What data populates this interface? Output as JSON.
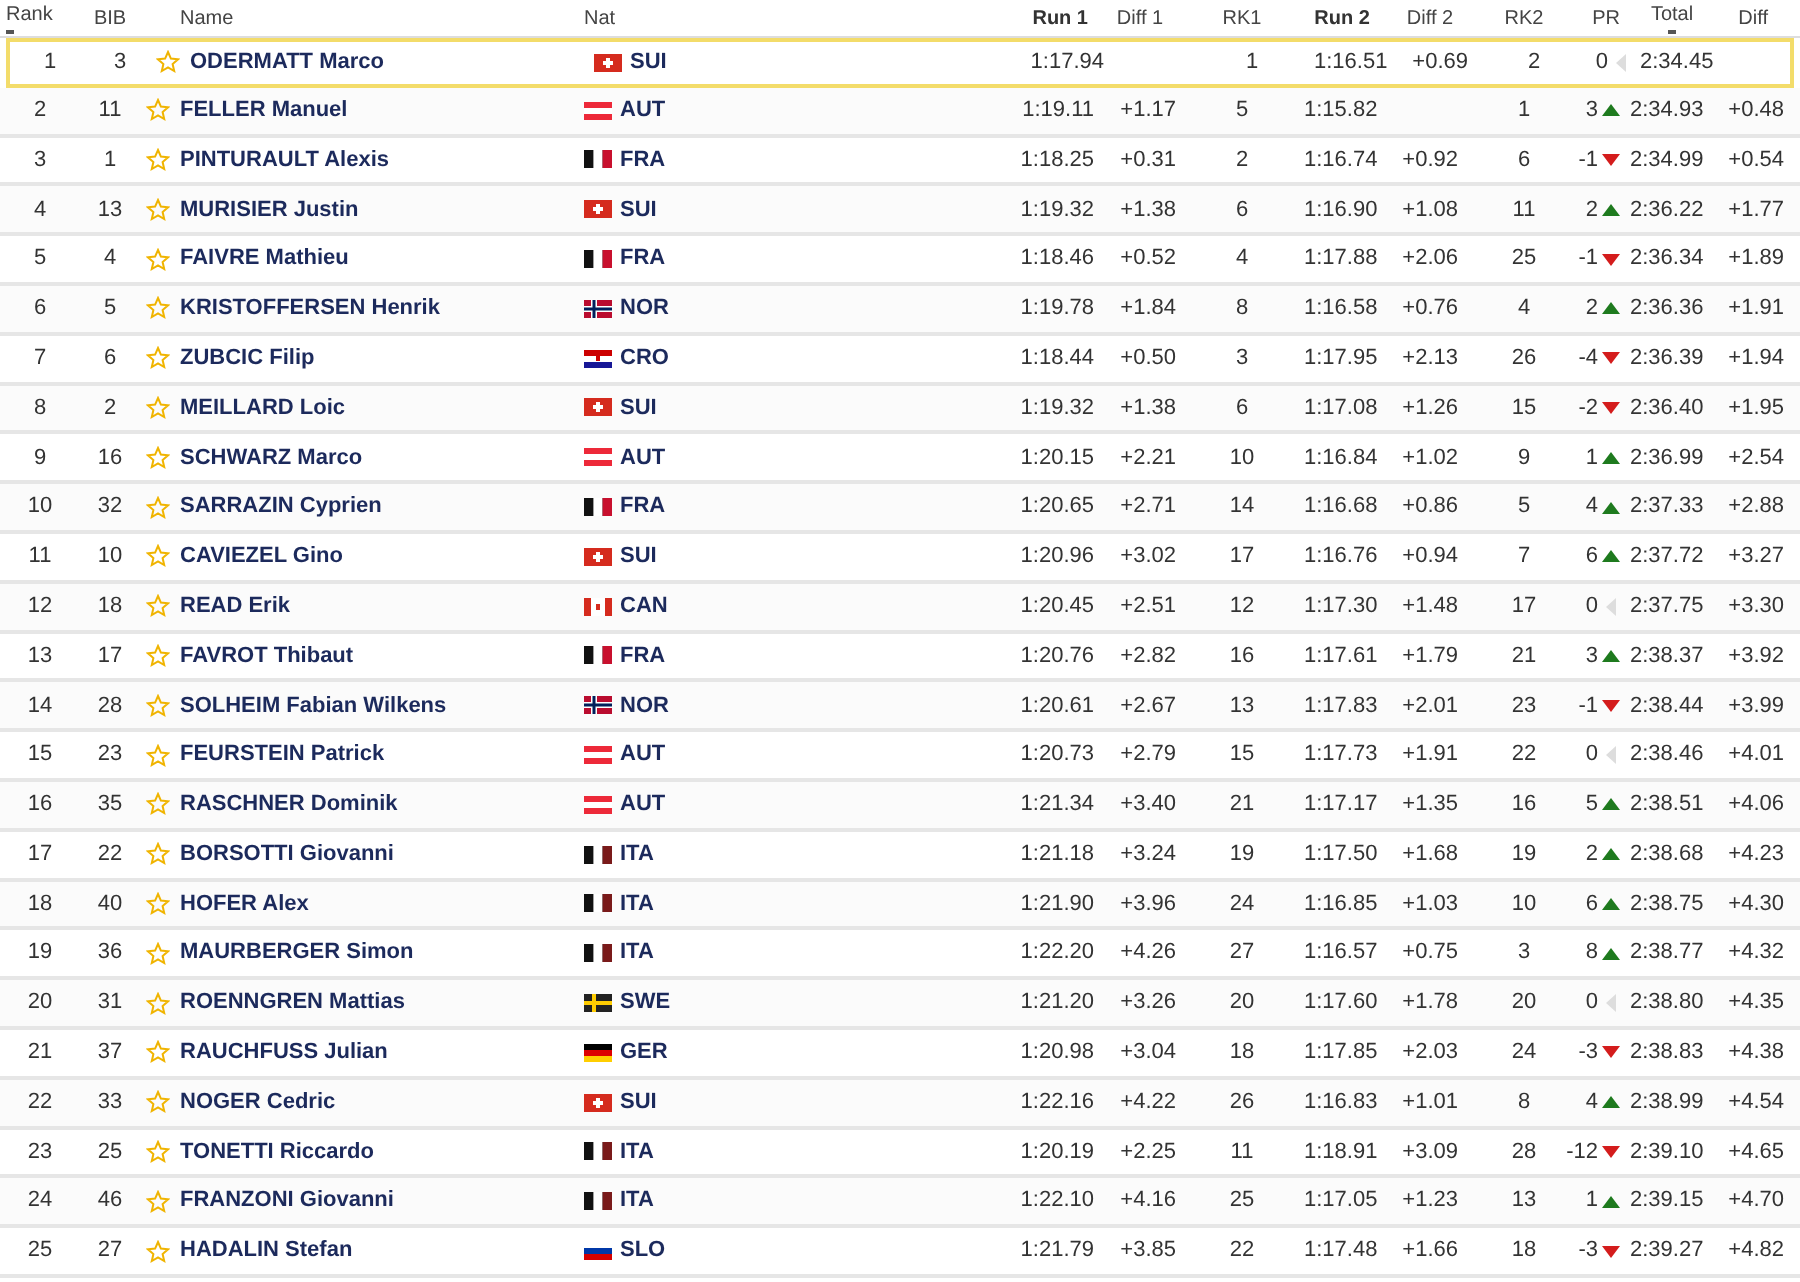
{
  "columns": [
    {
      "label": "Rank",
      "sorted": true
    },
    {
      "label": "BIB",
      "sorted": false
    },
    {
      "label": "Name",
      "sorted": false
    },
    {
      "label": "Nat",
      "sorted": false
    },
    {
      "label": "Run 1",
      "sorted": false
    },
    {
      "label": "Diff 1",
      "sorted": false
    },
    {
      "label": "RK1",
      "sorted": false
    },
    {
      "label": "Run 2",
      "sorted": false
    },
    {
      "label": "Diff 2",
      "sorted": false
    },
    {
      "label": "RK2",
      "sorted": false
    },
    {
      "label": "PR",
      "sorted": false
    },
    {
      "label": "Total",
      "sorted": true
    },
    {
      "label": "Diff",
      "sorted": false
    }
  ],
  "rows": [
    {
      "rank": "1",
      "bib": "3",
      "name": "ODERMATT Marco",
      "flag": {
        "kind": "swiss"
      },
      "nat": "SUI",
      "run1": "1:17.94",
      "rk1": "1",
      "run2": "1:16.51",
      "diff2": "+0.69",
      "rk2": "2",
      "pr": "0",
      "trend": {
        "kind": "same"
      },
      "total": "2:34.45",
      "selected": true
    },
    {
      "rank": "2",
      "bib": "11",
      "name": "FELLER Manuel",
      "flag": {
        "kind": "austrian"
      },
      "nat": "AUT",
      "run1": "1:19.11",
      "diff1": "+1.17",
      "rk1": "5",
      "run2": "1:15.82",
      "rk2": "1",
      "pr": "3",
      "trend": {
        "kind": "up"
      },
      "total": "2:34.93",
      "diff": "+0.48",
      "selected": false
    },
    {
      "rank": "3",
      "bib": "1",
      "name": "PINTURAULT Alexis",
      "flag": {
        "kind": "french"
      },
      "nat": "FRA",
      "run1": "1:18.25",
      "diff1": "+0.31",
      "rk1": "2",
      "run2": "1:16.74",
      "diff2": "+0.92",
      "rk2": "6",
      "pr": "-1",
      "trend": {
        "kind": "down"
      },
      "total": "2:34.99",
      "diff": "+0.54",
      "selected": false
    },
    {
      "rank": "4",
      "bib": "13",
      "name": "MURISIER Justin",
      "flag": {
        "kind": "swiss"
      },
      "nat": "SUI",
      "run1": "1:19.32",
      "diff1": "+1.38",
      "rk1": "6",
      "run2": "1:16.90",
      "diff2": "+1.08",
      "rk2": "11",
      "pr": "2",
      "trend": {
        "kind": "up"
      },
      "total": "2:36.22",
      "diff": "+1.77",
      "selected": false
    },
    {
      "rank": "5",
      "bib": "4",
      "name": "FAIVRE Mathieu",
      "flag": {
        "kind": "french"
      },
      "nat": "FRA",
      "run1": "1:18.46",
      "diff1": "+0.52",
      "rk1": "4",
      "run2": "1:17.88",
      "diff2": "+2.06",
      "rk2": "25",
      "pr": "-1",
      "trend": {
        "kind": "down"
      },
      "total": "2:36.34",
      "diff": "+1.89",
      "selected": false
    },
    {
      "rank": "6",
      "bib": "5",
      "name": "KRISTOFFERSEN Henrik",
      "flag": {
        "kind": "norwegian"
      },
      "nat": "NOR",
      "run1": "1:19.78",
      "diff1": "+1.84",
      "rk1": "8",
      "run2": "1:16.58",
      "diff2": "+0.76",
      "rk2": "4",
      "pr": "2",
      "trend": {
        "kind": "up"
      },
      "total": "2:36.36",
      "diff": "+1.91",
      "selected": false
    },
    {
      "rank": "7",
      "bib": "6",
      "name": "ZUBCIC Filip",
      "flag": {
        "kind": "croatian"
      },
      "nat": "CRO",
      "run1": "1:18.44",
      "diff1": "+0.50",
      "rk1": "3",
      "run2": "1:17.95",
      "diff2": "+2.13",
      "rk2": "26",
      "pr": "-4",
      "trend": {
        "kind": "down"
      },
      "total": "2:36.39",
      "diff": "+1.94",
      "selected": false
    },
    {
      "rank": "8",
      "bib": "2",
      "name": "MEILLARD Loic",
      "flag": {
        "kind": "swiss"
      },
      "nat": "SUI",
      "run1": "1:19.32",
      "diff1": "+1.38",
      "rk1": "6",
      "run2": "1:17.08",
      "diff2": "+1.26",
      "rk2": "15",
      "pr": "-2",
      "trend": {
        "kind": "down"
      },
      "total": "2:36.40",
      "diff": "+1.95",
      "selected": false
    },
    {
      "rank": "9",
      "bib": "16",
      "name": "SCHWARZ Marco",
      "flag": {
        "kind": "austrian"
      },
      "nat": "AUT",
      "run1": "1:20.15",
      "diff1": "+2.21",
      "rk1": "10",
      "run2": "1:16.84",
      "diff2": "+1.02",
      "rk2": "9",
      "pr": "1",
      "trend": {
        "kind": "up"
      },
      "total": "2:36.99",
      "diff": "+2.54",
      "selected": false
    },
    {
      "rank": "10",
      "bib": "32",
      "name": "SARRAZIN Cyprien",
      "flag": {
        "kind": "french"
      },
      "nat": "FRA",
      "run1": "1:20.65",
      "diff1": "+2.71",
      "rk1": "14",
      "run2": "1:16.68",
      "diff2": "+0.86",
      "rk2": "5",
      "pr": "4",
      "trend": {
        "kind": "up"
      },
      "total": "2:37.33",
      "diff": "+2.88",
      "selected": false
    },
    {
      "rank": "11",
      "bib": "10",
      "name": "CAVIEZEL Gino",
      "flag": {
        "kind": "swiss"
      },
      "nat": "SUI",
      "run1": "1:20.96",
      "diff1": "+3.02",
      "rk1": "17",
      "run2": "1:16.76",
      "diff2": "+0.94",
      "rk2": "7",
      "pr": "6",
      "trend": {
        "kind": "up"
      },
      "total": "2:37.72",
      "diff": "+3.27",
      "selected": false
    },
    {
      "rank": "12",
      "bib": "18",
      "name": "READ Erik",
      "flag": {
        "kind": "canadian"
      },
      "nat": "CAN",
      "run1": "1:20.45",
      "diff1": "+2.51",
      "rk1": "12",
      "run2": "1:17.30",
      "diff2": "+1.48",
      "rk2": "17",
      "pr": "0",
      "trend": {
        "kind": "same"
      },
      "total": "2:37.75",
      "diff": "+3.30",
      "selected": false
    },
    {
      "rank": "13",
      "bib": "17",
      "name": "FAVROT Thibaut",
      "flag": {
        "kind": "french"
      },
      "nat": "FRA",
      "run1": "1:20.76",
      "diff1": "+2.82",
      "rk1": "16",
      "run2": "1:17.61",
      "diff2": "+1.79",
      "rk2": "21",
      "pr": "3",
      "trend": {
        "kind": "up"
      },
      "total": "2:38.37",
      "diff": "+3.92",
      "selected": false
    },
    {
      "rank": "14",
      "bib": "28",
      "name": "SOLHEIM Fabian Wilkens",
      "flag": {
        "kind": "norwegian"
      },
      "nat": "NOR",
      "run1": "1:20.61",
      "diff1": "+2.67",
      "rk1": "13",
      "run2": "1:17.83",
      "diff2": "+2.01",
      "rk2": "23",
      "pr": "-1",
      "trend": {
        "kind": "down"
      },
      "total": "2:38.44",
      "diff": "+3.99",
      "selected": false
    },
    {
      "rank": "15",
      "bib": "23",
      "name": "FEURSTEIN Patrick",
      "flag": {
        "kind": "austrian"
      },
      "nat": "AUT",
      "run1": "1:20.73",
      "diff1": "+2.79",
      "rk1": "15",
      "run2": "1:17.73",
      "diff2": "+1.91",
      "rk2": "22",
      "pr": "0",
      "trend": {
        "kind": "same"
      },
      "total": "2:38.46",
      "diff": "+4.01",
      "selected": false
    },
    {
      "rank": "16",
      "bib": "35",
      "name": "RASCHNER Dominik",
      "flag": {
        "kind": "austrian"
      },
      "nat": "AUT",
      "run1": "1:21.34",
      "diff1": "+3.40",
      "rk1": "21",
      "run2": "1:17.17",
      "diff2": "+1.35",
      "rk2": "16",
      "pr": "5",
      "trend": {
        "kind": "up"
      },
      "total": "2:38.51",
      "diff": "+4.06",
      "selected": false
    },
    {
      "rank": "17",
      "bib": "22",
      "name": "BORSOTTI Giovanni",
      "flag": {
        "kind": "italian"
      },
      "nat": "ITA",
      "run1": "1:21.18",
      "diff1": "+3.24",
      "rk1": "19",
      "run2": "1:17.50",
      "diff2": "+1.68",
      "rk2": "19",
      "pr": "2",
      "trend": {
        "kind": "up"
      },
      "total": "2:38.68",
      "diff": "+4.23",
      "selected": false
    },
    {
      "rank": "18",
      "bib": "40",
      "name": "HOFER Alex",
      "flag": {
        "kind": "italian"
      },
      "nat": "ITA",
      "run1": "1:21.90",
      "diff1": "+3.96",
      "rk1": "24",
      "run2": "1:16.85",
      "diff2": "+1.03",
      "rk2": "10",
      "pr": "6",
      "trend": {
        "kind": "up"
      },
      "total": "2:38.75",
      "diff": "+4.30",
      "selected": false
    },
    {
      "rank": "19",
      "bib": "36",
      "name": "MAURBERGER Simon",
      "flag": {
        "kind": "italian"
      },
      "nat": "ITA",
      "run1": "1:22.20",
      "diff1": "+4.26",
      "rk1": "27",
      "run2": "1:16.57",
      "diff2": "+0.75",
      "rk2": "3",
      "pr": "8",
      "trend": {
        "kind": "up"
      },
      "total": "2:38.77",
      "diff": "+4.32",
      "selected": false
    },
    {
      "rank": "20",
      "bib": "31",
      "name": "ROENNGREN Mattias",
      "flag": {
        "kind": "swedish"
      },
      "nat": "SWE",
      "run1": "1:21.20",
      "diff1": "+3.26",
      "rk1": "20",
      "run2": "1:17.60",
      "diff2": "+1.78",
      "rk2": "20",
      "pr": "0",
      "trend": {
        "kind": "same"
      },
      "total": "2:38.80",
      "diff": "+4.35",
      "selected": false
    },
    {
      "rank": "21",
      "bib": "37",
      "name": "RAUCHFUSS Julian",
      "flag": {
        "kind": "german"
      },
      "nat": "GER",
      "run1": "1:20.98",
      "diff1": "+3.04",
      "rk1": "18",
      "run2": "1:17.85",
      "diff2": "+2.03",
      "rk2": "24",
      "pr": "-3",
      "trend": {
        "kind": "down"
      },
      "total": "2:38.83",
      "diff": "+4.38",
      "selected": false
    },
    {
      "rank": "22",
      "bib": "33",
      "name": "NOGER Cedric",
      "flag": {
        "kind": "swiss"
      },
      "nat": "SUI",
      "run1": "1:22.16",
      "diff1": "+4.22",
      "rk1": "26",
      "run2": "1:16.83",
      "diff2": "+1.01",
      "rk2": "8",
      "pr": "4",
      "trend": {
        "kind": "up"
      },
      "total": "2:38.99",
      "diff": "+4.54",
      "selected": false
    },
    {
      "rank": "23",
      "bib": "25",
      "name": "TONETTI Riccardo",
      "flag": {
        "kind": "italian"
      },
      "nat": "ITA",
      "run1": "1:20.19",
      "diff1": "+2.25",
      "rk1": "11",
      "run2": "1:18.91",
      "diff2": "+3.09",
      "rk2": "28",
      "pr": "-12",
      "trend": {
        "kind": "down"
      },
      "total": "2:39.10",
      "diff": "+4.65",
      "selected": false
    },
    {
      "rank": "24",
      "bib": "46",
      "name": "FRANZONI Giovanni",
      "flag": {
        "kind": "italian"
      },
      "nat": "ITA",
      "run1": "1:22.10",
      "diff1": "+4.16",
      "rk1": "25",
      "run2": "1:17.05",
      "diff2": "+1.23",
      "rk2": "13",
      "pr": "1",
      "trend": {
        "kind": "up"
      },
      "total": "2:39.15",
      "diff": "+4.70",
      "selected": false
    },
    {
      "rank": "25",
      "bib": "27",
      "name": "HADALIN Stefan",
      "flag": {
        "kind": "slovenian"
      },
      "nat": "SLO",
      "run1": "1:21.79",
      "diff1": "+3.85",
      "rk1": "22",
      "run2": "1:17.48",
      "diff2": "+1.66",
      "rk2": "18",
      "pr": "-3",
      "trend": {
        "kind": "down"
      },
      "total": "2:39.27",
      "diff": "+4.82",
      "selected": false
    }
  ]
}
